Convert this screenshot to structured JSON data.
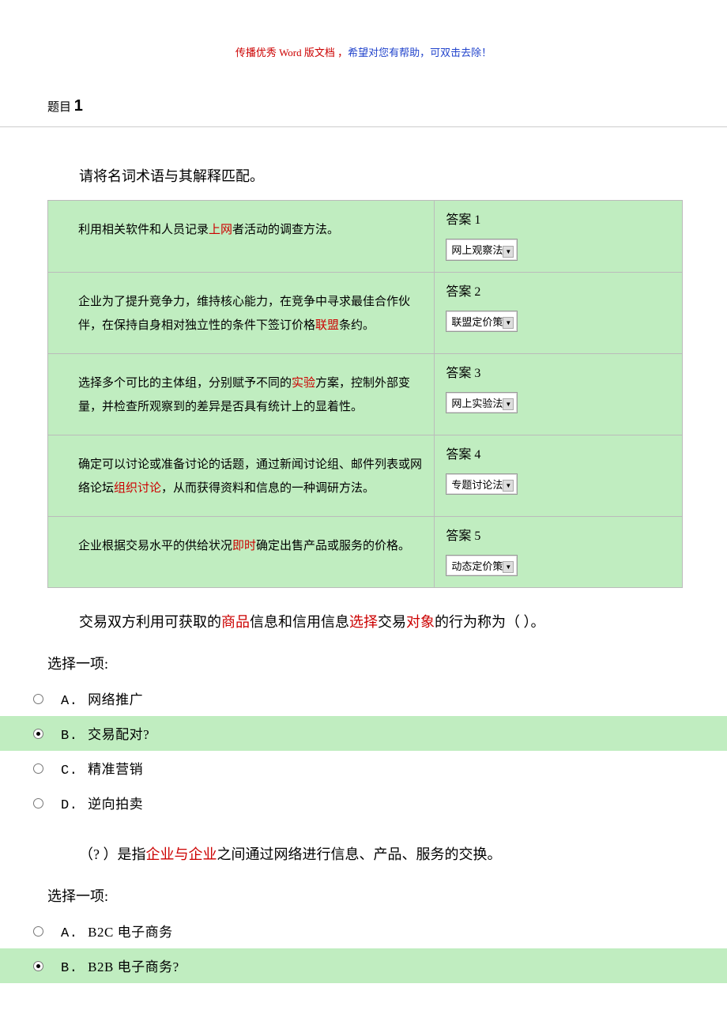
{
  "header_note": {
    "red": "传播优秀 Word 版文档 ，",
    "blue": "希望对您有帮助，可双击去除！"
  },
  "question_label": "题目",
  "question_number": "1",
  "q1": {
    "instruction": "请将名词术语与其解释匹配。",
    "rows": [
      {
        "desc_pre": "利用相关软件和人员记录",
        "desc_red": "上网",
        "desc_post": "者活动的调查方法。",
        "ans_label": "答案 1",
        "dropdown": "网上观察法"
      },
      {
        "desc_pre": "企业为了提升竞争力，维持核心能力，在竞争中寻求最佳合作伙伴，在保持自身相对独立性的条件下签订价格",
        "desc_red": "联盟",
        "desc_post": "条约。",
        "ans_label": "答案 2",
        "dropdown": "联盟定价策"
      },
      {
        "desc_pre": "选择多个可比的主体组，分别赋予不同的",
        "desc_red": "实验",
        "desc_post": "方案，控制外部变量，并检查所观察到的差异是否具有统计上的显着性。",
        "ans_label": "答案 3",
        "dropdown": "网上实验法"
      },
      {
        "desc_pre": "确定可以讨论或准备讨论的话题，通过新闻讨论组、邮件列表或网络论坛",
        "desc_red": "组织讨论",
        "desc_post": "，从而获得资料和信息的一种调研方法。",
        "ans_label": "答案 4",
        "dropdown": "专题讨论法"
      },
      {
        "desc_pre": "企业根据交易水平的供给状况",
        "desc_red": "即时",
        "desc_post": "确定出售产品或服务的价格。",
        "ans_label": "答案 5",
        "dropdown": "动态定价策"
      }
    ]
  },
  "q2": {
    "stem_parts": [
      "交易双方利用可获取的",
      "商品",
      "信息和信用信息",
      "选择",
      "交易",
      "对象",
      "的行为称为（ ）。"
    ],
    "choose_one": "选择一项:",
    "options": [
      {
        "letter": "A.",
        "text": "网络推广",
        "checked": false
      },
      {
        "letter": "B.",
        "text": "交易配对?",
        "checked": true
      },
      {
        "letter": "C.",
        "text": "精准营销",
        "checked": false
      },
      {
        "letter": "D.",
        "text": "逆向拍卖",
        "checked": false
      }
    ]
  },
  "q3": {
    "stem_parts": [
      "（?  ）是指",
      "企业与企业",
      "之间通过网络进行信息、产品、服务的交换。"
    ],
    "choose_one": "选择一项:",
    "options": [
      {
        "letter": "A.",
        "text": "B2C 电子商务",
        "checked": false
      },
      {
        "letter": "B.",
        "text": "B2B 电子商务?",
        "checked": true
      }
    ]
  }
}
